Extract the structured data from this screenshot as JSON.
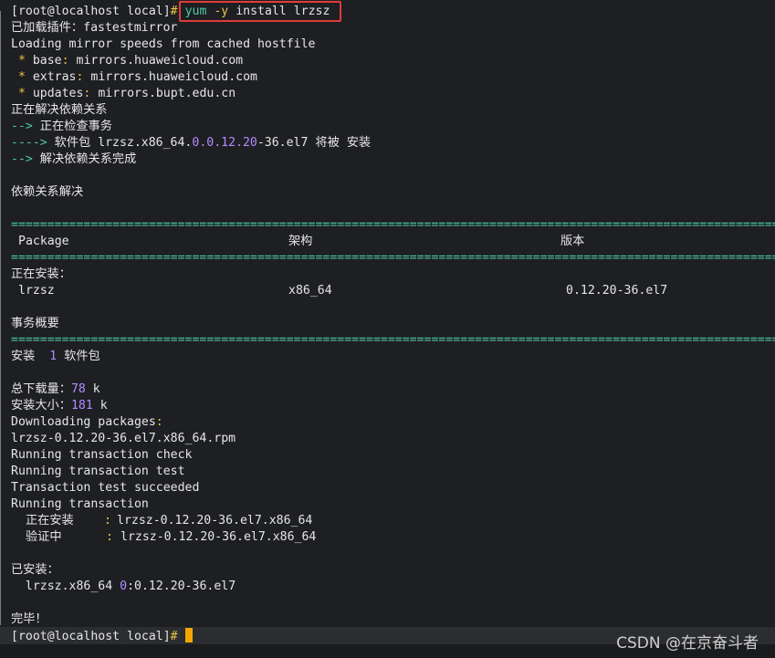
{
  "prompt_user_host": "[root@localhost local]",
  "prompt_hash": "#",
  "command": {
    "yum": "yum",
    "flag": "-y",
    "rest": " install lrzsz"
  },
  "lines": {
    "plugins": "已加载插件：fastestmirror",
    "loading": "Loading mirror speeds from cached hostfile",
    "base_label": "base",
    "base_val": "mirrors.huaweicloud.com",
    "extras_label": "extras",
    "extras_val": "mirrors.huaweicloud.com",
    "updates_label": "updates",
    "updates_val": "mirrors.bupt.edu.cn",
    "resolving": "正在解决依赖关系",
    "checking": "正在检查事务",
    "pkg_prefix": "软件包 lrzsz.x86_64.",
    "pkg_ver_a": "0",
    "pkg_ver_b": ".0.12.20",
    "pkg_ver_c": "-36.el7 将被 安装",
    "resolved_done": "解决依赖关系完成",
    "dep_resolved": "依赖关系解决",
    "installing_hdr": "正在安装：",
    "tx_summary": "事务概要",
    "install_label": "安装",
    "install_count": "1",
    "install_unit": "软件包",
    "total_dl_label": "总下载量：",
    "total_dl_val": "78",
    "total_dl_unit": "k",
    "inst_size_label": "安装大小：",
    "inst_size_val": "181",
    "inst_size_unit": "k",
    "downloading": "Downloading packages",
    "rpm_file": "lrzsz-0.12.20-36.el7.x86_64.rpm",
    "run_check": "Running transaction check",
    "run_test": "Running transaction test",
    "test_ok": "Transaction test succeeded",
    "run_tx": "Running transaction",
    "step_installing": "正在安装",
    "step_verifying": "验证中",
    "step_pkg": "lrzsz-0.12.20-36.el7.x86_64",
    "installed_hdr": "已安装：",
    "installed_pkg_a": "lrzsz.x86_64 ",
    "installed_pkg_b": "0",
    "installed_pkg_c": ":0.12.20-36.el7",
    "done": "完毕！"
  },
  "table": {
    "headers": [
      "Package",
      "架构",
      "版本"
    ],
    "row": [
      "lrzsz",
      "x86_64",
      "0.12.20-36.el7"
    ]
  },
  "watermark": "CSDN @在京奋斗者"
}
